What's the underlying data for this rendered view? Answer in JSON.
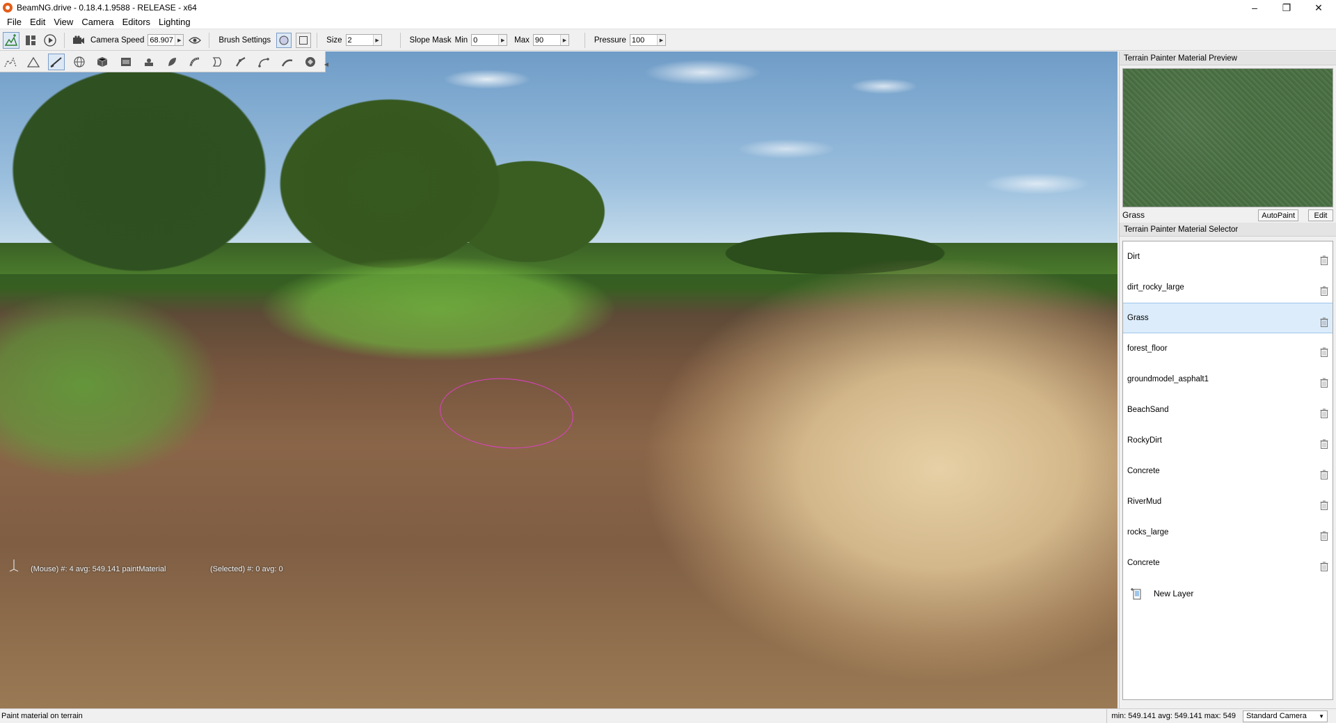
{
  "window": {
    "title": "BeamNG.drive - 0.18.4.1.9588 - RELEASE - x64",
    "minimize": "–",
    "maximize": "❐",
    "close": "✕"
  },
  "menu": [
    "File",
    "Edit",
    "View",
    "Camera",
    "Editors",
    "Lighting"
  ],
  "toolbar": {
    "camera_speed_label": "Camera Speed",
    "camera_speed_value": "68.907",
    "brush_settings_label": "Brush Settings",
    "size_label": "Size",
    "size_value": "2",
    "slope_mask_label": "Slope Mask",
    "min_label": "Min",
    "min_value": "0",
    "max_label": "Max",
    "max_value": "90",
    "pressure_label": "Pressure",
    "pressure_value": "100"
  },
  "viewport": {
    "status_mouse": "(Mouse) #: 4  avg: 549.141 paintMaterial",
    "status_selected": "(Selected) #: 0  avg: 0"
  },
  "preview_panel": {
    "header": "Terrain Painter Material Preview",
    "material_name": "Grass",
    "autopaint_label": "AutoPaint",
    "edit_label": "Edit"
  },
  "selector_panel": {
    "header": "Terrain Painter Material Selector",
    "materials": [
      {
        "name": "Dirt",
        "selected": false
      },
      {
        "name": "dirt_rocky_large",
        "selected": false
      },
      {
        "name": "Grass",
        "selected": true
      },
      {
        "name": "forest_floor",
        "selected": false
      },
      {
        "name": "groundmodel_asphalt1",
        "selected": false
      },
      {
        "name": "BeachSand",
        "selected": false
      },
      {
        "name": "RockyDirt",
        "selected": false
      },
      {
        "name": "Concrete",
        "selected": false
      },
      {
        "name": "RiverMud",
        "selected": false
      },
      {
        "name": "rocks_large",
        "selected": false
      },
      {
        "name": "Concrete",
        "selected": false
      }
    ],
    "new_layer_label": "New Layer"
  },
  "statusbar": {
    "left_text": "Paint material on terrain",
    "heights": "min: 549.141  avg: 549.141  max: 549",
    "camera_mode": "Standard Camera"
  },
  "colors": {
    "brush_outline": "#e040c8",
    "selection_bg": "#dcecfa"
  }
}
